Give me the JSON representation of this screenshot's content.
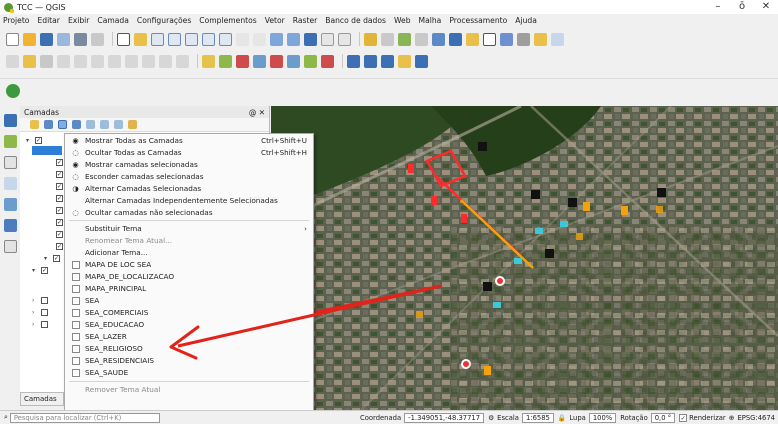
{
  "window": {
    "title": "TCC — QGIS",
    "controls": [
      "–",
      "ō",
      "✕"
    ]
  },
  "menubar": [
    "Projeto",
    "Editar",
    "Exibir",
    "Camada",
    "Configurações",
    "Complementos",
    "Vetor",
    "Raster",
    "Banco de dados",
    "Web",
    "Malha",
    "Processamento",
    "Ajuda"
  ],
  "layers_panel": {
    "title": "Camadas",
    "tab_label": "Camadas",
    "header_buttons": "@ ✕"
  },
  "context_menu": {
    "items": [
      {
        "label": "Mostrar Todas as Camadas",
        "shortcut": "Ctrl+Shift+U",
        "disabled": false,
        "icon": "eye-icon"
      },
      {
        "label": "Ocultar Todas as Camadas",
        "shortcut": "Ctrl+Shift+H",
        "disabled": false,
        "icon": "eye-closed-icon"
      },
      {
        "label": "Mostrar camadas selecionadas",
        "shortcut": "",
        "disabled": false,
        "icon": "eye-icon"
      },
      {
        "label": "Esconder camadas selecionadas",
        "shortcut": "",
        "disabled": false,
        "icon": "eye-closed-icon"
      },
      {
        "label": "Alternar Camadas Selecionadas",
        "shortcut": "",
        "disabled": false,
        "icon": "toggle-icon"
      },
      {
        "label": "Alternar Camadas Independentemente Selecionadas",
        "shortcut": "",
        "disabled": false,
        "icon": ""
      },
      {
        "label": "Ocultar camadas não selecionadas",
        "shortcut": "",
        "disabled": false,
        "icon": "eye-closed-icon"
      },
      {
        "label": "Substituir Tema",
        "shortcut": "",
        "disabled": false,
        "icon": "",
        "submenu": true
      },
      {
        "label": "Renomear Tema Atual...",
        "shortcut": "",
        "disabled": true,
        "icon": ""
      },
      {
        "label": "Adicionar Tema...",
        "shortcut": "",
        "disabled": false,
        "icon": ""
      },
      {
        "label": "MAPA DE LOC SEA",
        "shortcut": "",
        "disabled": false,
        "icon": "checkbox"
      },
      {
        "label": "MAPA_DE_LOCALIZACAO",
        "shortcut": "",
        "disabled": false,
        "icon": "checkbox"
      },
      {
        "label": "MAPA_PRINCIPAL",
        "shortcut": "",
        "disabled": false,
        "icon": "checkbox"
      },
      {
        "label": "SEA",
        "shortcut": "",
        "disabled": false,
        "icon": "checkbox"
      },
      {
        "label": "SEA_COMERCIAIS",
        "shortcut": "",
        "disabled": false,
        "icon": "checkbox"
      },
      {
        "label": "SEA_EDUCACAO",
        "shortcut": "",
        "disabled": false,
        "icon": "checkbox"
      },
      {
        "label": "SEA_LAZER",
        "shortcut": "",
        "disabled": false,
        "icon": "checkbox"
      },
      {
        "label": "SEA_RELIGIOSO",
        "shortcut": "",
        "disabled": false,
        "icon": "checkbox"
      },
      {
        "label": "SEA_RESIDENCIAIS",
        "shortcut": "",
        "disabled": false,
        "icon": "checkbox"
      },
      {
        "label": "SEA_SAUDE",
        "shortcut": "",
        "disabled": false,
        "icon": "checkbox"
      },
      {
        "label": "Remover Tema Atual",
        "shortcut": "",
        "disabled": true,
        "icon": ""
      }
    ]
  },
  "statusbar": {
    "search_placeholder": "Pesquisa para localizar (Ctrl+K)",
    "coord_label": "Coordenada",
    "coord_value": "-1.349051,-48.37717",
    "scale_label": "Escala",
    "scale_value": "1:6585",
    "magnifier_label": "Lupa",
    "magnifier_value": "100%",
    "rotation_label": "Rotação",
    "rotation_value": "0,0 °",
    "render_label": "Renderizar",
    "crs_label": "EPSG:4674"
  },
  "colors": {
    "accent": "#2d7fd6",
    "arrow": "#e0241b",
    "route_yellow": "#f3a20c",
    "highlight": "#ff2a2a"
  }
}
